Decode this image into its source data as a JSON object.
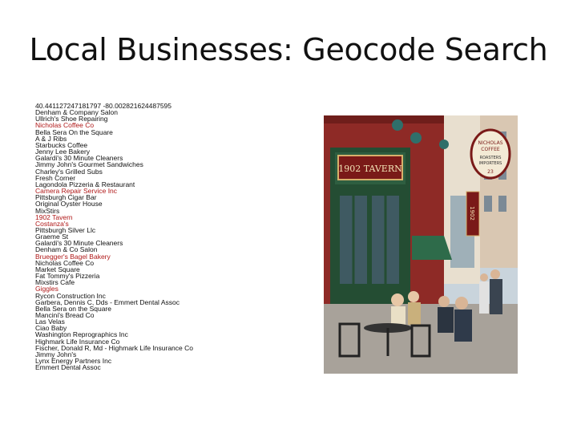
{
  "title": "Local Businesses: Geocode Search",
  "coordinates": "40.441127247181797 -80.002821624487595",
  "results": [
    {
      "name": "Denham & Company Salon",
      "highlight": false
    },
    {
      "name": "Ullrich's Shoe Repairing",
      "highlight": false
    },
    {
      "name": "Nicholas Coffee Co",
      "highlight": true
    },
    {
      "name": "Bella Sera On the Square",
      "highlight": false
    },
    {
      "name": "A & J Ribs",
      "highlight": false
    },
    {
      "name": "Starbucks Coffee",
      "highlight": false
    },
    {
      "name": "Jenny Lee Bakery",
      "highlight": false
    },
    {
      "name": "Galardi's 30 Minute Cleaners",
      "highlight": false
    },
    {
      "name": "Jimmy John's Gourmet Sandwiches",
      "highlight": false
    },
    {
      "name": "Charley's Grilled Subs",
      "highlight": false
    },
    {
      "name": "Fresh Corner",
      "highlight": false
    },
    {
      "name": "Lagondola Pizzeria & Restaurant",
      "highlight": false
    },
    {
      "name": "Camera Repair Service Inc",
      "highlight": true
    },
    {
      "name": "Pittsburgh Cigar Bar",
      "highlight": false
    },
    {
      "name": "Original Oyster House",
      "highlight": false
    },
    {
      "name": "MixStirs",
      "highlight": false
    },
    {
      "name": "1902 Tavern",
      "highlight": true
    },
    {
      "name": "Costanza's",
      "highlight": true
    },
    {
      "name": "Pittsburgh Silver Llc",
      "highlight": false
    },
    {
      "name": "Graeme St",
      "highlight": false
    },
    {
      "name": "Galardi's 30 Minute Cleaners",
      "highlight": false
    },
    {
      "name": "Denham & Co Salon",
      "highlight": false
    },
    {
      "name": "Bruegger's Bagel Bakery",
      "highlight": true
    },
    {
      "name": "Nicholas Coffee Co",
      "highlight": false
    },
    {
      "name": "Market Square",
      "highlight": false
    },
    {
      "name": "Fat Tommy's Pizzeria",
      "highlight": false
    },
    {
      "name": "Mixstirs Cafe",
      "highlight": false
    },
    {
      "name": "Giggles",
      "highlight": true
    },
    {
      "name": "Rycon Construction Inc",
      "highlight": false
    },
    {
      "name": "Garbera, Dennis C, Dds - Emmert Dental Assoc",
      "highlight": false
    },
    {
      "name": "Bella Sera on the Square",
      "highlight": false
    },
    {
      "name": "Mancini's Bread Co",
      "highlight": false
    },
    {
      "name": "Las Velas",
      "highlight": false
    },
    {
      "name": "Ciao Baby",
      "highlight": false
    },
    {
      "name": "Washington Reprographics Inc",
      "highlight": false
    },
    {
      "name": "Highmark Life Insurance Co",
      "highlight": false
    },
    {
      "name": "Fischer, Donald R, Md - Highmark Life Insurance Co",
      "highlight": false
    },
    {
      "name": "Jimmy John's",
      "highlight": false
    },
    {
      "name": "Lynx Energy Partners Inc",
      "highlight": false
    },
    {
      "name": "Emmert Dental Assoc",
      "highlight": false
    }
  ],
  "photo": {
    "signs": {
      "tavern": "1902 TAVERN",
      "nicholas_top": "NICHOLAS",
      "nicholas_mid": "COFFEE",
      "nicholas_roasters": "ROASTERS",
      "nicholas_importers": "IMPORTERS",
      "nicholas_num": "23",
      "vertical": "1902"
    }
  }
}
